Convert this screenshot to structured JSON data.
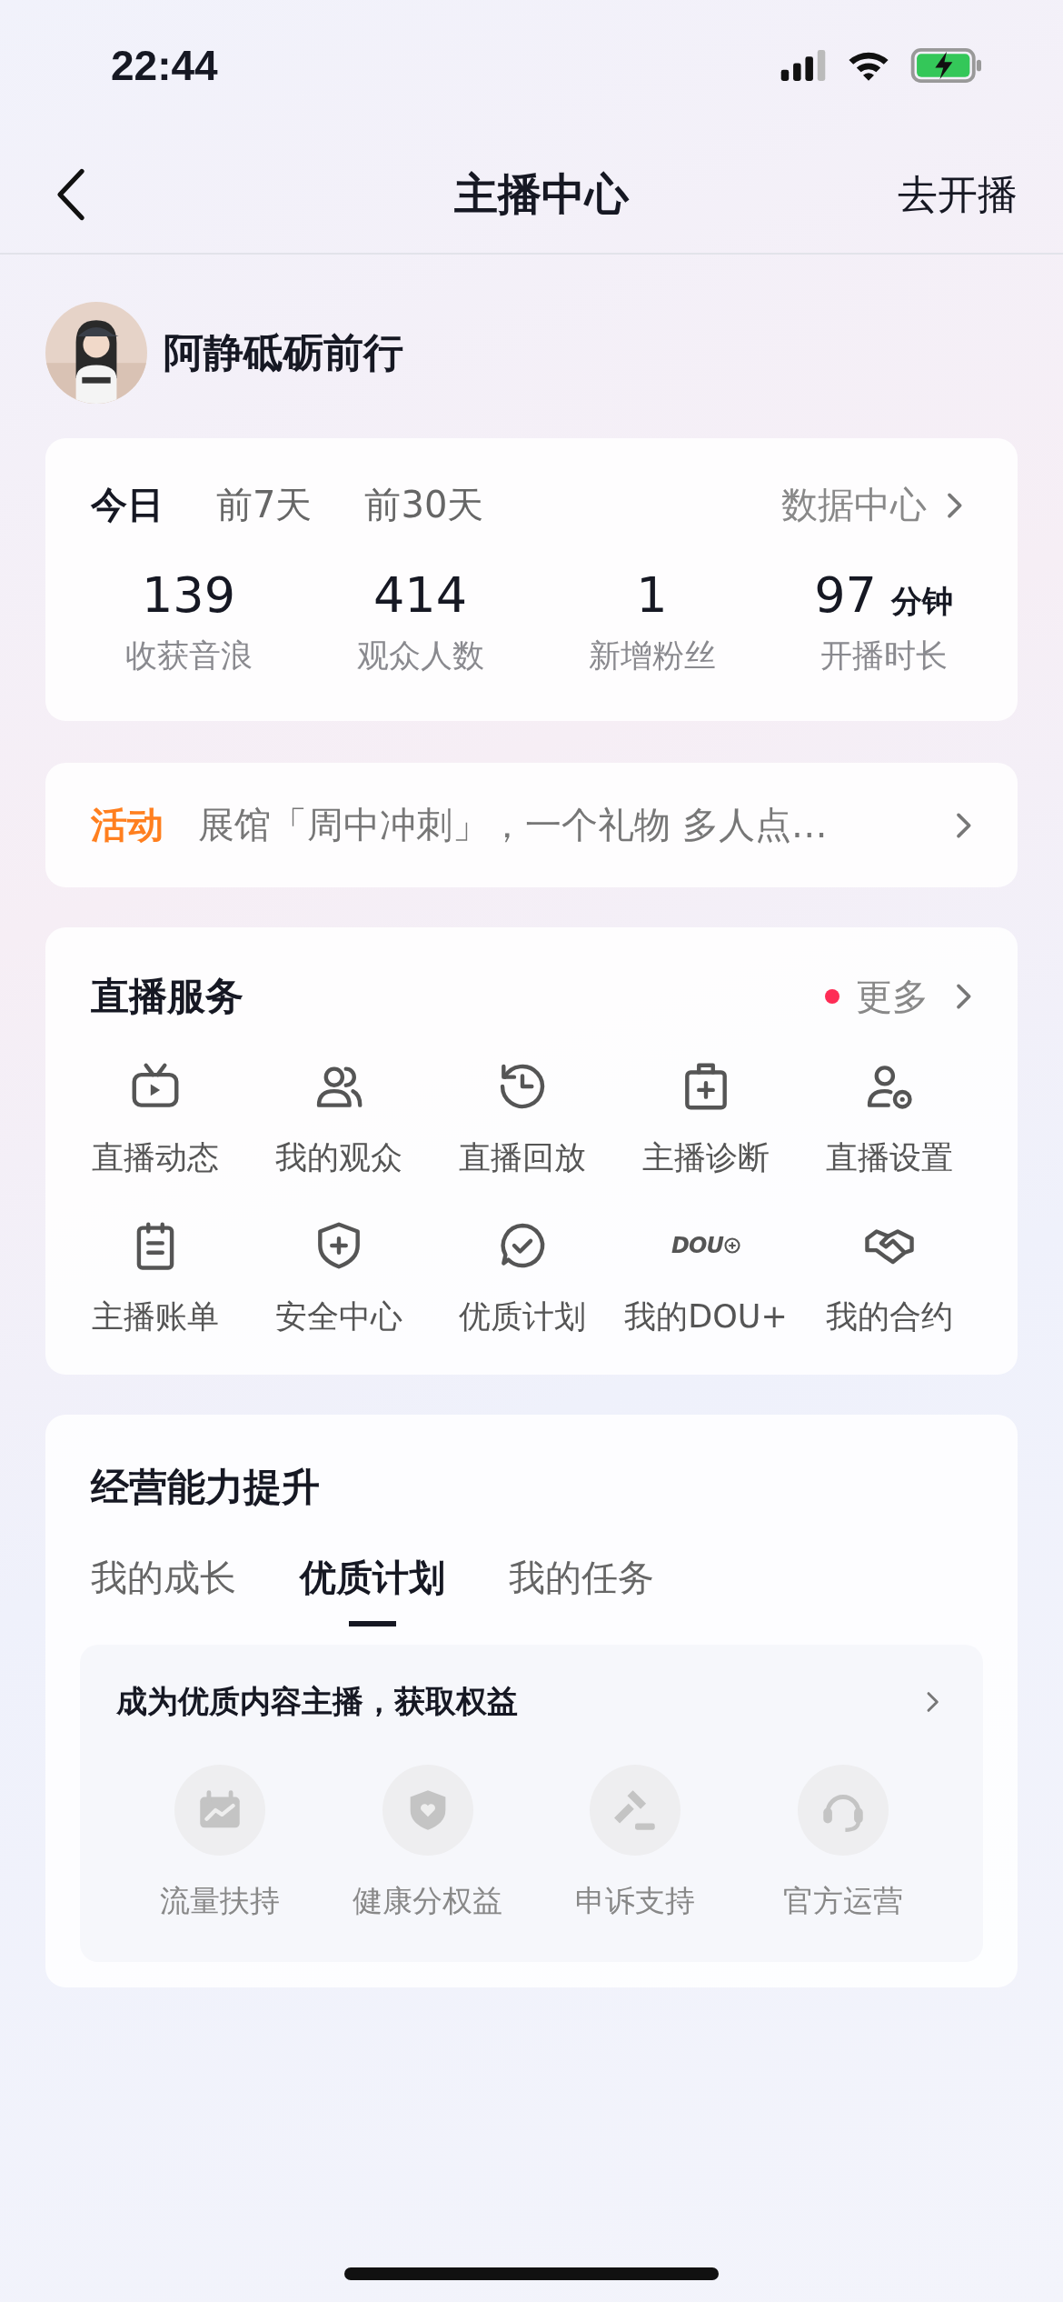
{
  "status_bar": {
    "time": "22:44"
  },
  "nav": {
    "title": "主播中心",
    "action": "去开播"
  },
  "profile": {
    "name": "阿静砥砺前行"
  },
  "stats": {
    "tabs": [
      {
        "label": "今日",
        "selected": true
      },
      {
        "label": "前7天",
        "selected": false
      },
      {
        "label": "前30天",
        "selected": false
      }
    ],
    "link": "数据中心",
    "items": [
      {
        "value": "139",
        "label": "收获音浪"
      },
      {
        "value": "414",
        "label": "观众人数"
      },
      {
        "value": "1",
        "label": "新增粉丝"
      },
      {
        "value": "97",
        "unit": "分钟",
        "label": "开播时长"
      }
    ]
  },
  "activity": {
    "tag": "活动",
    "text": "展馆「周中冲刺」，一个礼物 多人点…"
  },
  "services": {
    "title": "直播服务",
    "more": "更多",
    "more_dot": true,
    "items": [
      {
        "label": "直播动态"
      },
      {
        "label": "我的观众"
      },
      {
        "label": "直播回放"
      },
      {
        "label": "主播诊断"
      },
      {
        "label": "直播设置"
      },
      {
        "label": "主播账单"
      },
      {
        "label": "安全中心"
      },
      {
        "label": "优质计划"
      },
      {
        "label": "我的DOU+",
        "logo": "DOU"
      },
      {
        "label": "我的合约"
      }
    ]
  },
  "growth": {
    "title": "经营能力提升",
    "tabs": [
      {
        "label": "我的成长",
        "selected": false
      },
      {
        "label": "优质计划",
        "selected": true
      },
      {
        "label": "我的任务",
        "selected": false
      }
    ],
    "panel": {
      "title": "成为优质内容主播，获取权益",
      "benefits": [
        {
          "label": "流量扶持"
        },
        {
          "label": "健康分权益"
        },
        {
          "label": "申诉支持"
        },
        {
          "label": "官方运营"
        }
      ]
    }
  }
}
